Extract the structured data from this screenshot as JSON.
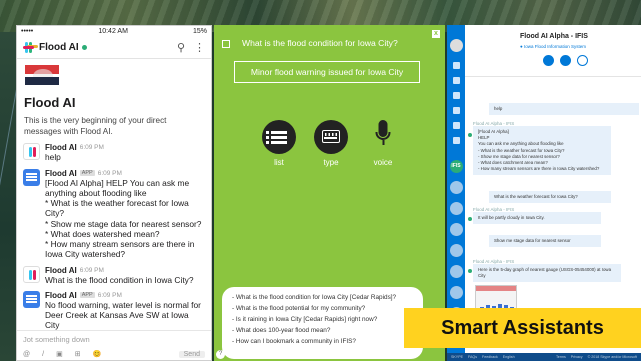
{
  "slack": {
    "status": {
      "carrier": "•••••",
      "time": "10:42 AM",
      "battery": "15%"
    },
    "header_title": "Flood AI",
    "channel_name": "Flood AI",
    "intro": "This is the very beginning of your direct messages with Flood AI.",
    "messages": [
      {
        "author": "Flood AI",
        "tag": "",
        "time": "6:09 PM",
        "text": "help"
      },
      {
        "author": "Flood AI",
        "tag": "APP",
        "time": "6:09 PM",
        "text": "[Flood AI Alpha]  HELP  You can ask me anything about flooding like\n* What is the weather forecast for Iowa City?\n* Show me stage data for nearest sensor?\n* What does watershed mean?\n* How many stream sensors are there in Iowa City watershed?"
      },
      {
        "author": "Flood AI",
        "tag": "",
        "time": "6:09 PM",
        "text": "What is the flood condition in Iowa City?"
      },
      {
        "author": "Flood AI",
        "tag": "APP",
        "time": "6:09 PM",
        "text": "No flood warning, water level is normal for Deer Creek at Kansas Ave SW at Iowa City"
      }
    ],
    "composer_placeholder": "Jot something down",
    "send_label": "Send",
    "bottom_icons": [
      "@",
      "/",
      "▣",
      "⊞",
      "😊"
    ]
  },
  "assistant": {
    "close_label": "x",
    "question": "What is the flood condition  for Iowa City?",
    "answer": "Minor flood warning issued for Iowa City",
    "modes": [
      {
        "icon": "list-icon",
        "label": "list"
      },
      {
        "icon": "keyboard-icon",
        "label": "type"
      },
      {
        "icon": "microphone-icon",
        "label": "voice"
      }
    ],
    "suggestions": [
      "- What is the flood condition for Iowa City [Cedar Rapids]?",
      "- What is the flood potential for my community?",
      "- Is it raining in Iowa City [Cedar Rapids] right now?",
      "- What does 100-year flood mean?",
      "- How can I bookmark a community in IFIS?"
    ],
    "help_label": "?",
    "colors": {
      "panel": "#8bc53f",
      "icon_circle": "#222222"
    }
  },
  "skype": {
    "title": "Flood AI Alpha - IFIS",
    "subtitle": "● Iowa Flood Information System",
    "side_badge": "IFIS",
    "chat": [
      {
        "sender": "",
        "text": "help"
      },
      {
        "sender": "Flood AI Alpha - IFIS",
        "text": "[Flood AI Alpha]\nHELP\nYou can ask me anything about flooding like\n- What is the weather forecast for Iowa City?\n- Show me stage data for nearest sensor?\n- What does catchment area mean?\n- How many stream sensors are there in Iowa City watershed?"
      },
      {
        "sender": "",
        "text": "What is the weather forecast for Iowa City?"
      },
      {
        "sender": "Flood AI Alpha - IFIS",
        "text": "It will be partly cloudy in Iowa City."
      },
      {
        "sender": "",
        "text": "Show me stage data for nearest sensor"
      },
      {
        "sender": "Flood AI Alpha - IFIS",
        "text": "Here is the 5-day graph of nearest gauge (USGS-05454000) at Iowa City"
      }
    ],
    "footer_left": [
      "SKYPE",
      "FAQs",
      "Feedback",
      "English"
    ],
    "footer_right": [
      "Terms",
      "Privacy",
      "© 2018 Skype and/or Microsoft"
    ]
  },
  "caption": "Smart Assistants"
}
